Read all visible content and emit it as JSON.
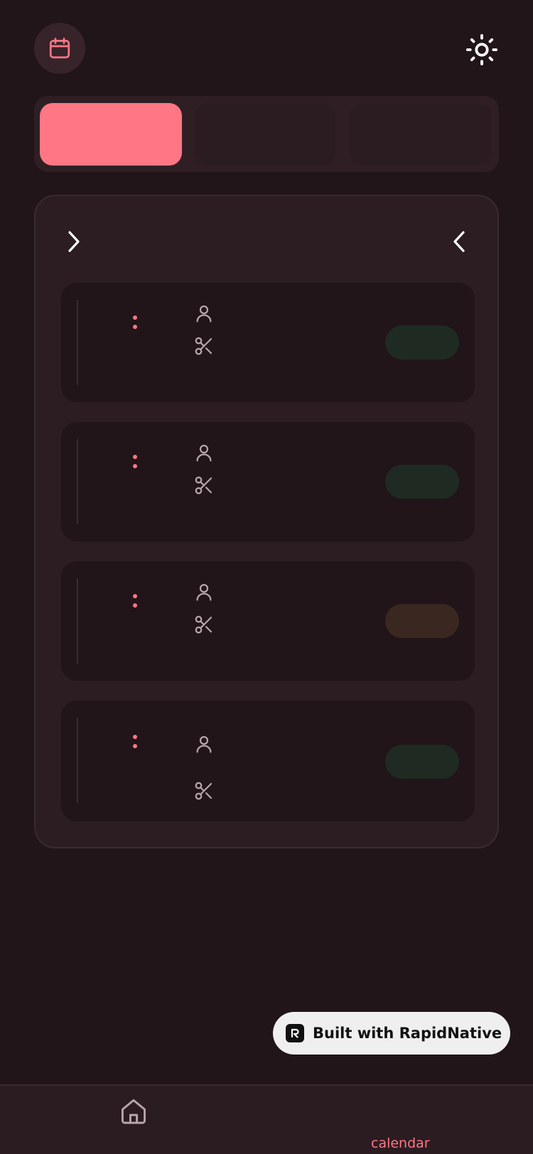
{
  "header": {
    "calendar_icon": "calendar-icon",
    "theme_icon": "sun-icon"
  },
  "segments": [
    {
      "label": "",
      "active": true
    },
    {
      "label": "",
      "active": false
    },
    {
      "label": "",
      "active": false
    }
  ],
  "panel": {
    "next_icon": "chevron-right-icon",
    "prev_icon": "chevron-left-icon",
    "cards": [
      {
        "status_color": "#1f2a23"
      },
      {
        "status_color": "#1f2a23"
      },
      {
        "status_color": "#3a2720"
      },
      {
        "status_color": "#1f2a23"
      }
    ]
  },
  "badge": {
    "label": "Built with RapidNative"
  },
  "tabbar": {
    "home_icon": "home-icon",
    "calendar_label": "calendar"
  },
  "colors": {
    "accent": "#ff7685",
    "background": "#211519",
    "surface": "#2b1d22"
  }
}
